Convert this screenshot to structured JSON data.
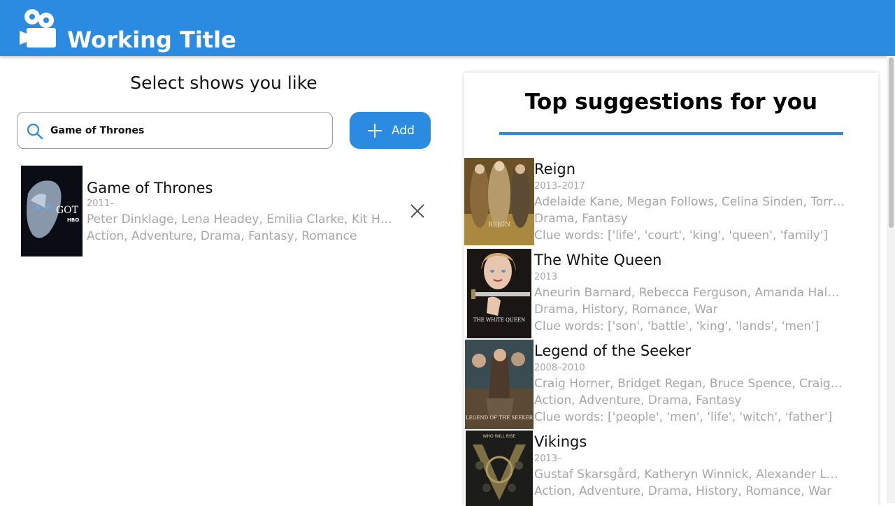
{
  "app": {
    "title": "Working Title",
    "brand_color": "#2a8be1",
    "logo_icon": "film-camera-icon"
  },
  "left": {
    "heading": "Select shows you like",
    "search": {
      "value": "Game of Thrones",
      "icon": "search-icon"
    },
    "add_label": "Add",
    "selected": [
      {
        "title": "Game of Thrones",
        "years": "2011–",
        "cast": "Peter Dinklage, Lena Headey, Emilia Clarke, Kit Harington",
        "genres": "Action, Adventure, Drama, Fantasy, Romance",
        "poster_text": "GOT",
        "poster_subtext": "HBO"
      }
    ]
  },
  "suggestions": {
    "title": "Top suggestions for you",
    "items": [
      {
        "title": "Reign",
        "years": "2013–2017",
        "cast": "Adelaide Kane, Megan Follows, Celina Sinden, Torrance Coombs",
        "genres": "Drama, Fantasy",
        "clues": "Clue words: ['life', 'court', 'king', 'queen', 'family']",
        "poster_text": "REIGN"
      },
      {
        "title": "The White Queen",
        "years": "2013",
        "cast": "Aneurin Barnard, Rebecca Ferguson, Amanda Hale, Faye Marsay",
        "genres": "Drama, History, Romance, War",
        "clues": "Clue words: ['son', 'battle', 'king', 'lands', 'men']",
        "poster_text": "THE WHITE QUEEN"
      },
      {
        "title": "Legend of the Seeker",
        "years": "2008–2010",
        "cast": "Craig Horner, Bridget Regan, Bruce Spence, Craig Parker",
        "genres": "Action, Adventure, Drama, Fantasy",
        "clues": "Clue words: ['people', 'men', 'life', 'witch', 'father']",
        "poster_text": "LEGEND OF THE SEEKER"
      },
      {
        "title": "Vikings",
        "years": "2013–",
        "cast": "Gustaf Skarsgård, Katheryn Winnick, Alexander Ludwig, Travis Fimmel",
        "genres": "Action, Adventure, Drama, History, Romance, War",
        "clues": "",
        "poster_text": "WHO WILL RISE"
      }
    ]
  }
}
